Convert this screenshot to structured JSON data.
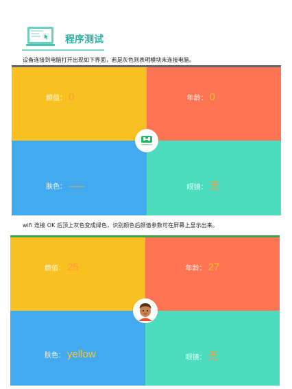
{
  "header": {
    "title": "程序测试"
  },
  "captions": {
    "first": "设备连接到电脑打开出现如下界面，若是灰色则表明模块未连接电脑。",
    "second": "wifi 连接 OK 后顶上灰色变成绿色，识别颜色后颜值参数可在屏幕上显示出来。"
  },
  "panels": [
    {
      "status": "disconnected",
      "status_color": "#666666",
      "appearance_label": "颜值：",
      "appearance_value": "0",
      "age_label": "年龄：",
      "age_value": "0",
      "skin_label": "肤色：",
      "skin_value": "------",
      "glasses_label": "眼镜：",
      "glasses_value": "无",
      "center_icon": "module-logo-icon"
    },
    {
      "status": "connected",
      "status_color": "#3aa64a",
      "appearance_label": "颜值：",
      "appearance_value": "25",
      "age_label": "年龄：",
      "age_value": "27",
      "skin_label": "肤色：",
      "skin_value": "yellow",
      "glasses_label": "眼镜：",
      "glasses_value": "无",
      "center_icon": "avatar-icon"
    }
  ],
  "colors": {
    "accent": "#2ab3a0",
    "value_text": "#ff9a3c",
    "yellow": "#f8c021",
    "orange": "#ff7452",
    "blue": "#44aaef",
    "teal": "#4cdcbe"
  }
}
